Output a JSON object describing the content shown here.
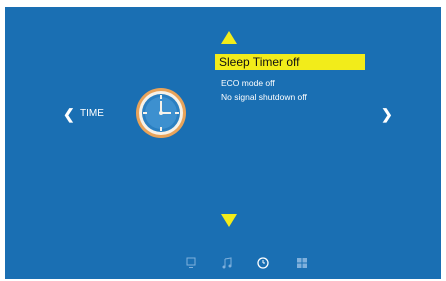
{
  "menu": {
    "selected": "Sleep Timer off",
    "items": [
      "ECO mode off",
      "No signal shutdown off"
    ]
  },
  "nav": {
    "left_label": "TIME",
    "left_glyph": "❮",
    "right_glyph": "❯"
  },
  "colors": {
    "background": "#1a6fb3",
    "highlight": "#f2ec1a",
    "clock_ring": "#e8a35a"
  },
  "icons": {
    "up": "arrow-up-icon",
    "down": "arrow-down-icon",
    "clock": "clock-icon",
    "bottom": [
      "monitor-icon",
      "music-note-icon",
      "clock-icon",
      "grid-icon"
    ]
  }
}
